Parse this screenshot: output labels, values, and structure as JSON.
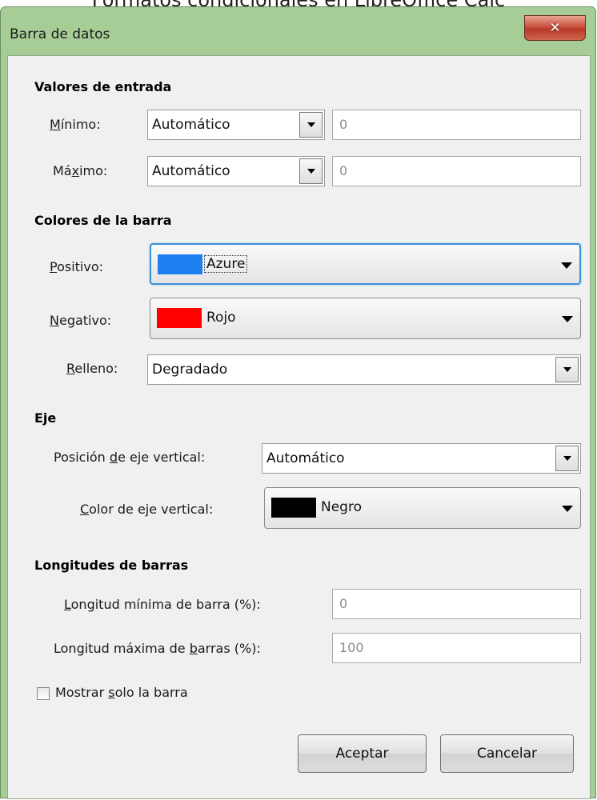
{
  "page": {
    "background_title": "Formatos condicionales en LibreOffice Calc"
  },
  "window": {
    "title": "Barra de datos",
    "close_icon": "close-icon"
  },
  "sections": {
    "entrada": {
      "heading": "Valores de entrada",
      "minimo": {
        "label": "Mínimo:",
        "mnemonic": "M",
        "rest": "ínimo:",
        "mode": "Automático",
        "value": "0"
      },
      "maximo": {
        "label": "Máximo:",
        "pre": "Má",
        "mnemonic": "x",
        "rest": "imo:",
        "mode": "Automático",
        "value": "0"
      }
    },
    "colores": {
      "heading": "Colores de la barra",
      "positivo": {
        "label": "Positivo:",
        "mnemonic": "P",
        "rest": "ositivo:",
        "color_name": "Azure",
        "color": "#1e7ff0"
      },
      "negativo": {
        "label": "Negativo:",
        "mnemonic": "N",
        "rest": "egativo:",
        "color_name": "Rojo",
        "color": "#ff0000"
      },
      "relleno": {
        "label": "Relleno:",
        "mnemonic": "R",
        "rest": "elleno:",
        "value": "Degradado"
      }
    },
    "eje": {
      "heading": "Eje",
      "posicion": {
        "label": "Posición de eje vertical:",
        "pre": "Posición ",
        "mnemonic": "d",
        "rest": "e eje vertical:",
        "value": "Automático"
      },
      "color": {
        "label": "Color de eje vertical:",
        "mnemonic": "C",
        "rest": "olor de eje vertical:",
        "color_name": "Negro",
        "color": "#000000"
      }
    },
    "longitudes": {
      "heading": "Longitudes de barras",
      "minima": {
        "label": "Longitud mínima de barra (%):",
        "mnemonic": "L",
        "rest": "ongitud mínima de barra (%):",
        "value": "0"
      },
      "maxima": {
        "label": "Longitud máxima de barras (%):",
        "pre": "Longitud máxima de ",
        "mnemonic": "b",
        "rest": "arras (%):",
        "value": "100"
      }
    }
  },
  "options": {
    "solo_barra": {
      "label": "Mostrar solo la barra",
      "pre": "Mostrar ",
      "mnemonic": "s",
      "rest": "olo la barra",
      "checked": false
    }
  },
  "buttons": {
    "ok": "Aceptar",
    "cancel": "Cancelar"
  }
}
